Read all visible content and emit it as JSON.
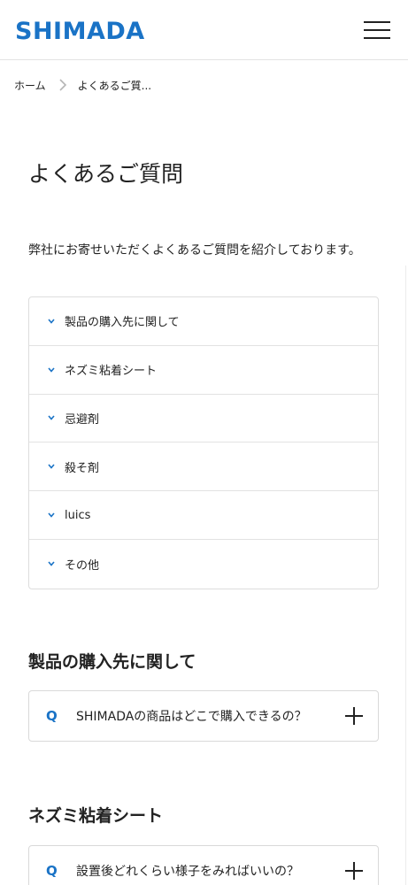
{
  "header": {
    "logo_text": "SHIMADA",
    "menu_icon": "hamburger-menu-icon",
    "brand_color": "#1a73c6"
  },
  "breadcrumb": {
    "home": "ホーム",
    "current": "よくあるご質..."
  },
  "page": {
    "title": "よくあるご質問",
    "intro": "弊社にお寄せいただくよくあるご質問を紹介しております。"
  },
  "toc": {
    "items": [
      {
        "label": "製品の購入先に関して"
      },
      {
        "label": "ネズミ粘着シート"
      },
      {
        "label": "忌避剤"
      },
      {
        "label": "殺そ剤"
      },
      {
        "label": "luics"
      },
      {
        "label": "その他"
      }
    ]
  },
  "sections": [
    {
      "title": "製品の購入先に関して",
      "q_mark": "Q",
      "question": "SHIMADAの商品はどこで購入できるの？"
    },
    {
      "title": "ネズミ粘着シート",
      "q_mark": "Q",
      "question": "設置後どれくらい様子をみればいいの？"
    }
  ]
}
